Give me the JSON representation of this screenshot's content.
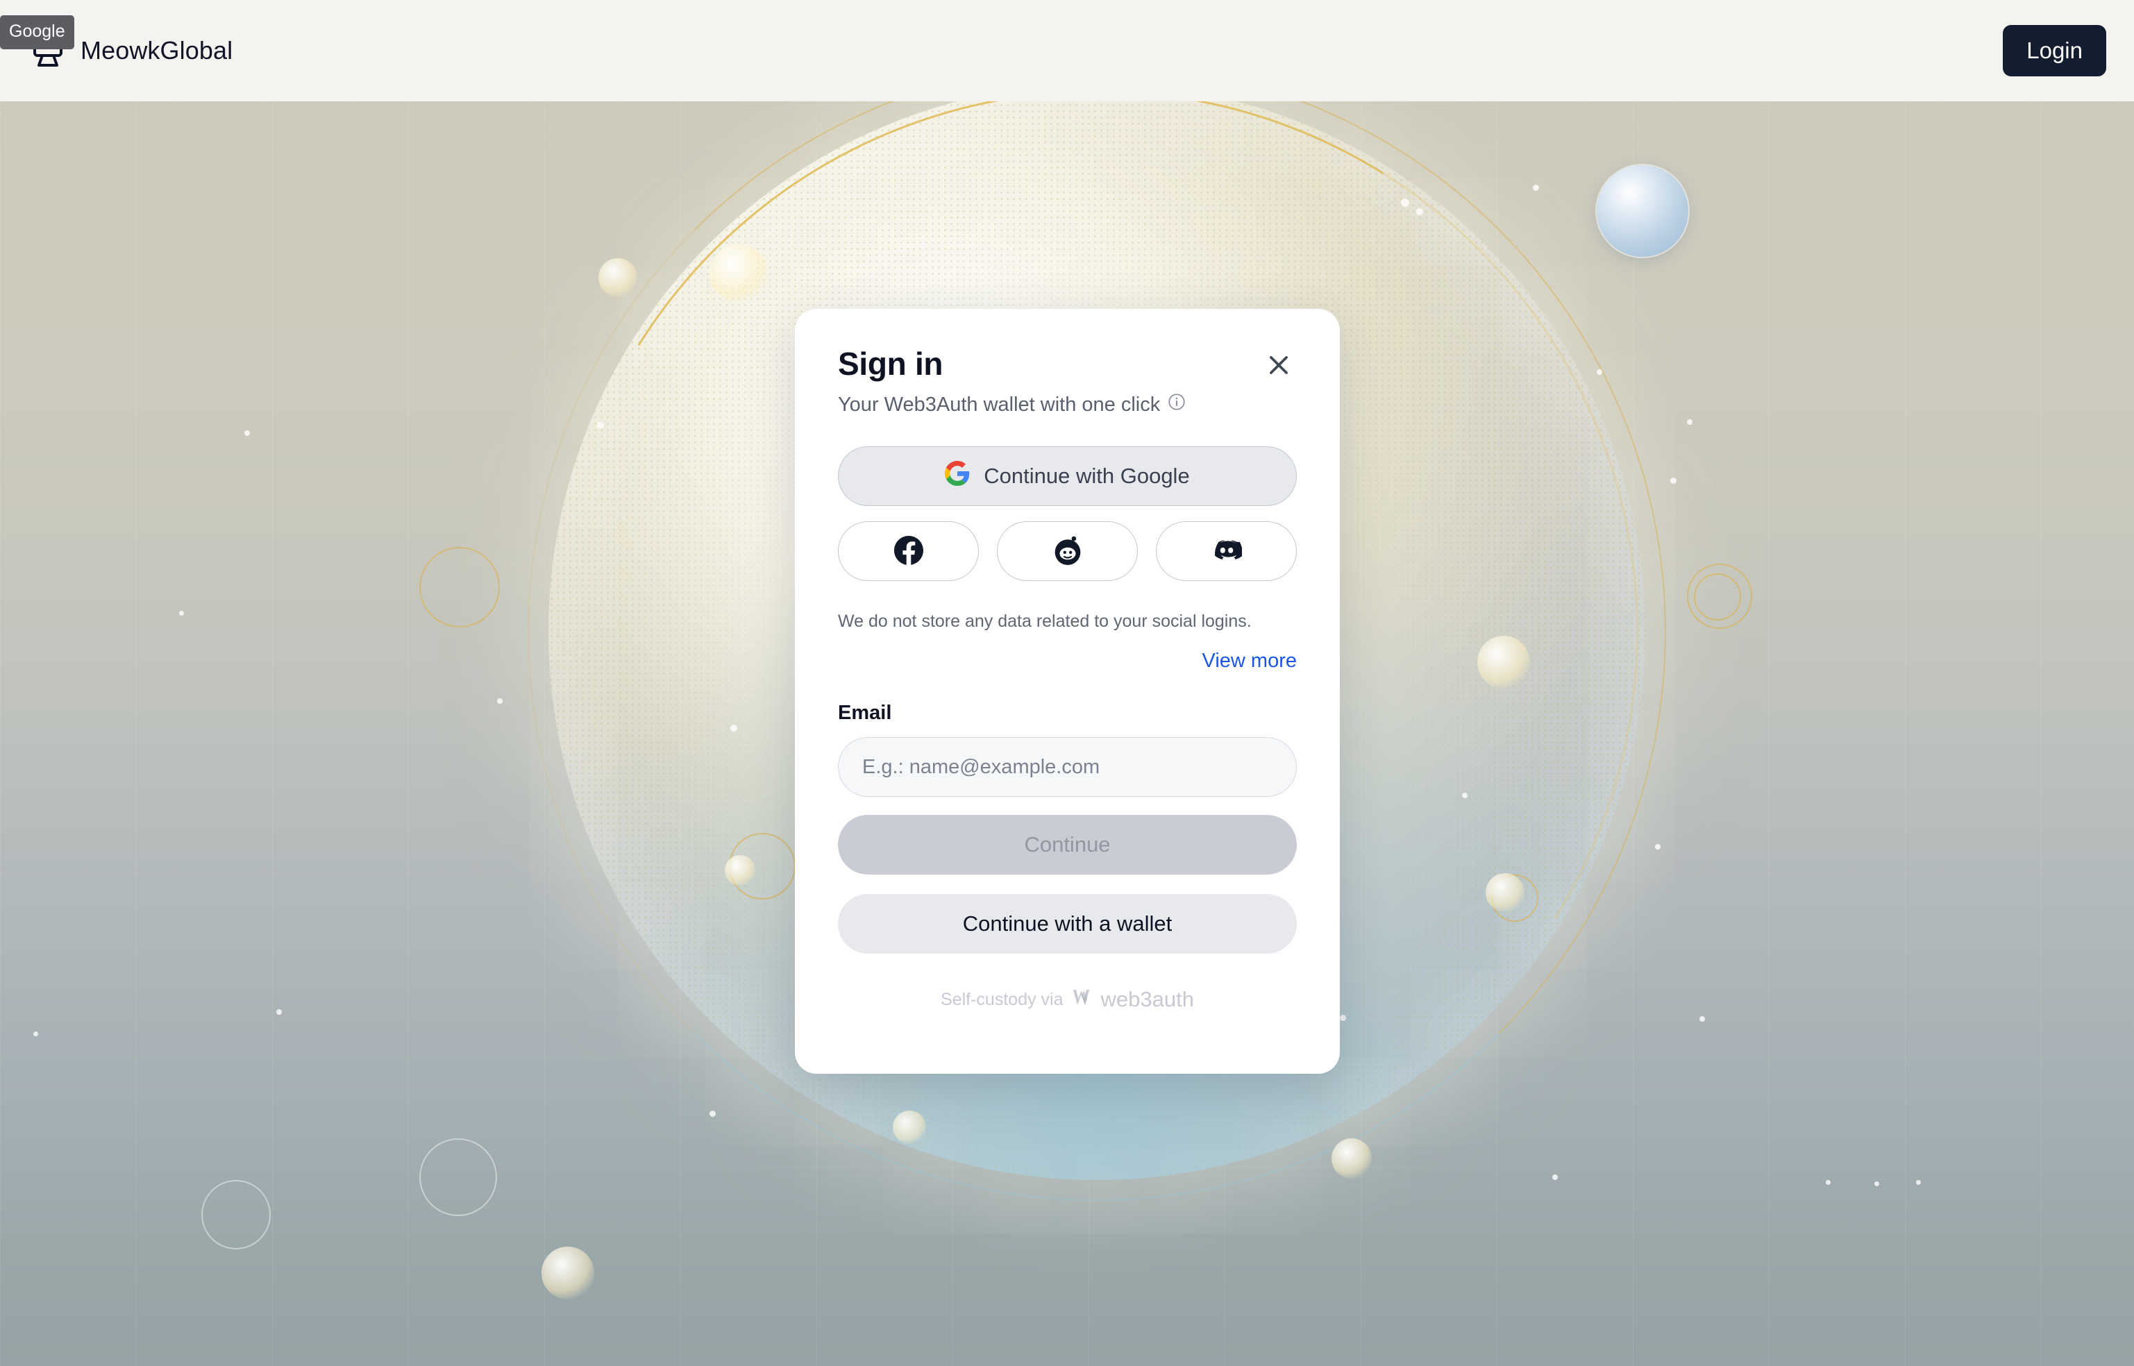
{
  "header": {
    "brand_name": "MeowkGlobal",
    "brand_logo_icon": "monitor-logo-icon",
    "google_badge": "Google",
    "login_label": "Login"
  },
  "modal": {
    "title": "Sign in",
    "subtitle": "Your Web3Auth wallet with one click",
    "info_icon": "info-circle-icon",
    "close_icon": "close-icon",
    "google_button": {
      "label": "Continue with Google",
      "icon": "google-g-icon"
    },
    "social_buttons": [
      {
        "name": "facebook",
        "icon": "facebook-icon"
      },
      {
        "name": "reddit",
        "icon": "reddit-icon"
      },
      {
        "name": "discord",
        "icon": "discord-icon"
      }
    ],
    "privacy_note": "We do not store any data related to your social logins.",
    "view_more_label": "View more",
    "email_label": "Email",
    "email_value": "",
    "email_placeholder": "E.g.: name@example.com",
    "continue_label": "Continue",
    "continue_disabled": true,
    "wallet_label": "Continue with a wallet",
    "footer_text": "Self-custody via",
    "footer_brand": "web3auth",
    "footer_brand_icon": "web3auth-w-icon"
  },
  "colors": {
    "header_bg": "#f4f3f0",
    "login_bg": "#141c30",
    "link_blue": "#1a56e8",
    "modal_bg": "#ffffff",
    "google_btn_bg": "#e7e9ed",
    "continue_disabled_bg": "#c9ccd4",
    "badge_bg": "#5b5d62",
    "scene_top": "#cdcabb",
    "scene_bottom": "#95a3a6",
    "accent_gold": "#d6b460"
  }
}
